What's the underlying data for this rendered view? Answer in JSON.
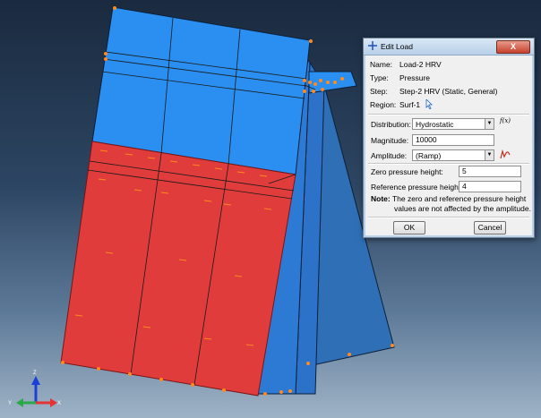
{
  "triad": {
    "z_label": "Z",
    "y_label": "Y",
    "x_label": "X"
  },
  "dialog": {
    "title": "Edit Load",
    "close_label": "X",
    "name_label": "Name:",
    "name_value": "Load-2 HRV",
    "type_label": "Type:",
    "type_value": "Pressure",
    "step_label": "Step:",
    "step_value": "Step-2 HRV (Static, General)",
    "region_label": "Region:",
    "region_value": "Surf-1",
    "distribution_label": "Distribution:",
    "distribution_value": "Hydrostatic",
    "fx_label": "f(x)",
    "magnitude_label": "Magnitude:",
    "magnitude_value": "10000",
    "amplitude_label": "Amplitude:",
    "amplitude_value": "(Ramp)",
    "zero_height_label": "Zero pressure height:",
    "zero_height_value": "5",
    "ref_height_label": "Reference pressure height:",
    "ref_height_value": "4",
    "note_bold": "Note:",
    "note_line1": "The zero and reference pressure height",
    "note_line2": "values are not affected by the amplitude.",
    "ok_label": "OK",
    "cancel_label": "Cancel"
  },
  "colors": {
    "pressure_region": "#e03c3c",
    "model_blue": "#2a8ff0",
    "support_blue": "#2f6fb5",
    "load_arrow": "#ff8a1e"
  }
}
